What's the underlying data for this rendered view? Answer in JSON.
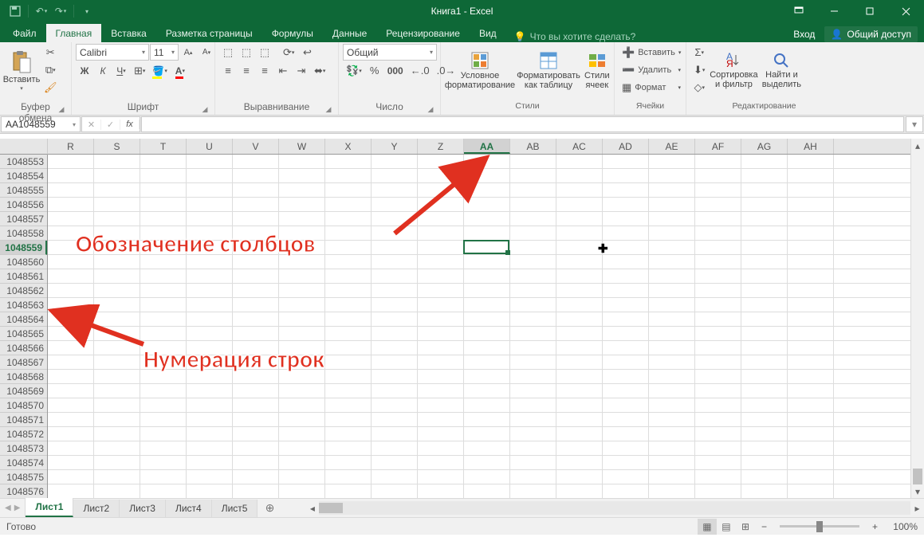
{
  "title": "Книга1 - Excel",
  "qat": {
    "save": "💾",
    "undo": "↶",
    "redo": "↷"
  },
  "win": {
    "login": "Вход",
    "share": "Общий доступ"
  },
  "tabs": [
    "Файл",
    "Главная",
    "Вставка",
    "Разметка страницы",
    "Формулы",
    "Данные",
    "Рецензирование",
    "Вид"
  ],
  "active_tab": 1,
  "tellme": "Что вы хотите сделать?",
  "ribbon": {
    "clipboard": {
      "paste": "Вставить",
      "label": "Буфер обмена"
    },
    "font": {
      "name": "Calibri",
      "size": "11",
      "label": "Шрифт"
    },
    "align": {
      "label": "Выравнивание"
    },
    "number": {
      "format": "Общий",
      "label": "Число"
    },
    "styles": {
      "cond": "Условное форматирование",
      "table": "Форматировать как таблицу",
      "cell": "Стили ячеек",
      "label": "Стили"
    },
    "cells": {
      "insert": "Вставить",
      "delete": "Удалить",
      "format": "Формат",
      "label": "Ячейки"
    },
    "editing": {
      "sort": "Сортировка и фильтр",
      "find": "Найти и выделить",
      "label": "Редактирование"
    }
  },
  "namebox": "AA1048559",
  "columns": [
    "R",
    "S",
    "T",
    "U",
    "V",
    "W",
    "X",
    "Y",
    "Z",
    "AA",
    "AB",
    "AC",
    "AD",
    "AE",
    "AF",
    "AG",
    "AH"
  ],
  "sel_col_index": 9,
  "rows": [
    1048553,
    1048554,
    1048555,
    1048556,
    1048557,
    1048558,
    1048559,
    1048560,
    1048561,
    1048562,
    1048563,
    1048564,
    1048565,
    1048566,
    1048567,
    1048568,
    1048569,
    1048570,
    1048571,
    1048572,
    1048573,
    1048574,
    1048575,
    1048576
  ],
  "sel_row_index": 6,
  "annotations": {
    "cols": "Обозначение столбцов",
    "rows": "Нумерация строк"
  },
  "sheets": [
    "Лист1",
    "Лист2",
    "Лист3",
    "Лист4",
    "Лист5"
  ],
  "active_sheet": 0,
  "status": "Готово",
  "zoom": "100%"
}
